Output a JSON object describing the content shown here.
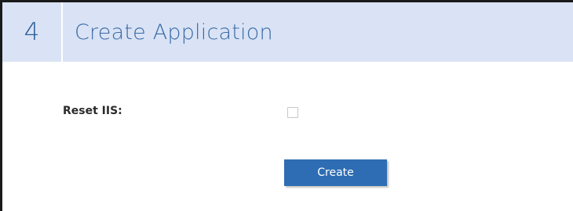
{
  "header": {
    "step_number": "4",
    "title": "Create Application"
  },
  "form": {
    "reset_iis_label": "Reset IIS:",
    "reset_iis_checked": false,
    "create_label": "Create"
  },
  "colors": {
    "header_background": "#d9e3f5",
    "header_text": "#3a6aa6",
    "button_background": "#2e6db3",
    "button_text": "#ffffff"
  }
}
